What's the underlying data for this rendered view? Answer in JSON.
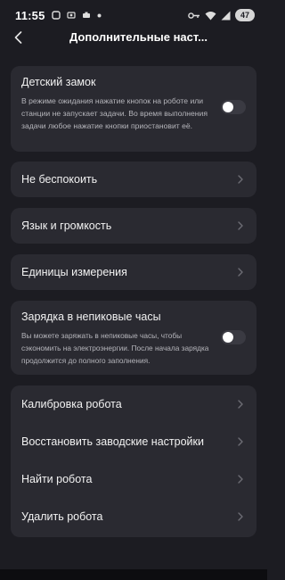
{
  "status_bar": {
    "time": "11:55",
    "battery": "47"
  },
  "header": {
    "title": "Дополнительные наст..."
  },
  "child_lock": {
    "label": "Детский замок",
    "description": "В режиме ожидания нажатие кнопок на роботе или станции не запускает задачи. Во время выполнения задачи любое нажатие кнопки приостановит её.",
    "enabled": false
  },
  "dnd": {
    "label": "Не беспокоить"
  },
  "language_volume": {
    "label": "Язык и громкость"
  },
  "units": {
    "label": "Единицы измерения"
  },
  "offpeak": {
    "label": "Зарядка в непиковые часы",
    "description": "Вы можете заряжать в непиковые часы, чтобы сэкономить на электроэнергии. После начала зарядка продолжится до полного заполнения.",
    "enabled": false
  },
  "robot_actions": [
    {
      "label": "Калибровка робота"
    },
    {
      "label": "Восстановить заводские настройки"
    },
    {
      "label": "Найти робота"
    },
    {
      "label": "Удалить робота"
    }
  ]
}
